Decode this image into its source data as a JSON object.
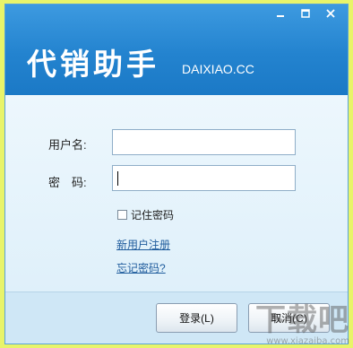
{
  "header": {
    "logo_text": "代销助手",
    "domain": "DAIXIAO.CC"
  },
  "window_controls": {
    "minimize_icon": "minimize-icon",
    "maximize_icon": "maximize-icon",
    "close_icon": "close-icon"
  },
  "form": {
    "username_label": "用户名:",
    "username_value": "",
    "password_label": "密　码:",
    "password_value": "",
    "remember_label": "记住密码",
    "remember_checked": false,
    "register_link": "新用户注册",
    "forgot_link": "忘记密码?"
  },
  "buttons": {
    "login": "登录(L)",
    "cancel": "取消(C)"
  },
  "watermark": {
    "title": "下载吧",
    "url": "www.xiazaiba.com"
  },
  "colors": {
    "header_blue": "#2383cf",
    "link": "#1e5b9c",
    "outer_background": "#e8f46a"
  }
}
